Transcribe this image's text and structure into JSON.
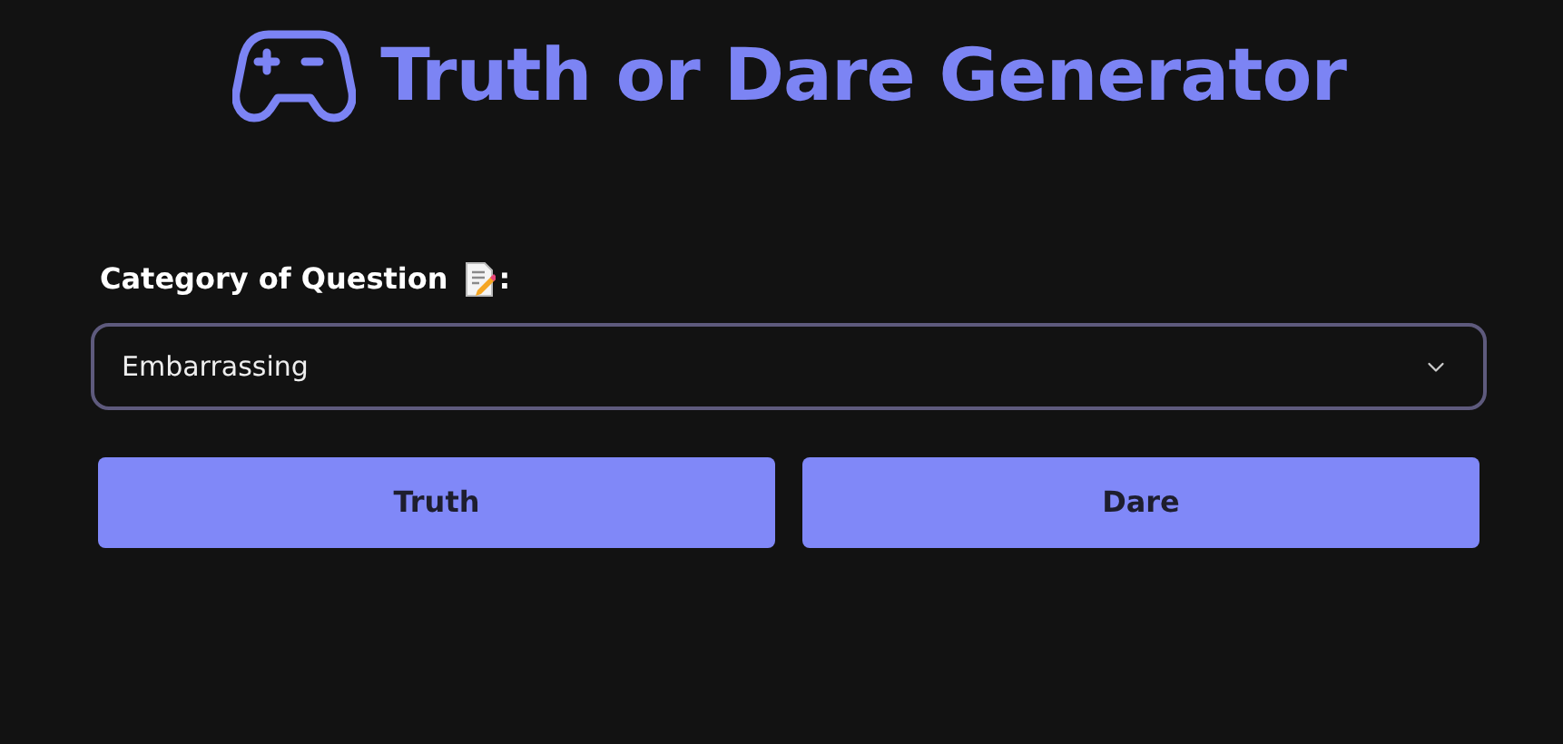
{
  "title": "Truth or Dare Generator",
  "category": {
    "label": "Category of Question",
    "label_suffix": ":",
    "value": "Embarrassing"
  },
  "buttons": [
    "Truth",
    "Dare"
  ]
}
